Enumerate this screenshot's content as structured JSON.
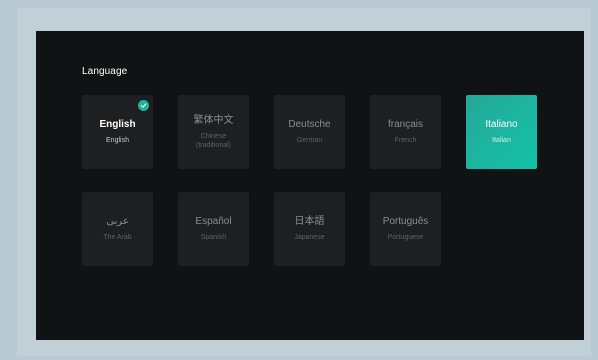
{
  "section": {
    "title": "Language"
  },
  "languages": [
    {
      "native": "English",
      "english": "English",
      "state": "current"
    },
    {
      "native": "繁体中文",
      "english": "Chinese (traditional)",
      "state": ""
    },
    {
      "native": "Deutsche",
      "english": "German",
      "state": ""
    },
    {
      "native": "français",
      "english": "French",
      "state": ""
    },
    {
      "native": "Italiano",
      "english": "Italian",
      "state": "highlight"
    },
    {
      "native": "عربى",
      "english": "The Arab",
      "state": ""
    },
    {
      "native": "Español",
      "english": "Spanish",
      "state": ""
    },
    {
      "native": "日本語",
      "english": "Japanese",
      "state": ""
    },
    {
      "native": "Português",
      "english": "Portuguese",
      "state": ""
    }
  ],
  "icons": {
    "selected": "check-circle-icon"
  },
  "colors": {
    "accent": "#1fb39c",
    "screen_background": "#111213",
    "tile_background": "#1e1f21",
    "frame_background": "#b9cad4"
  }
}
